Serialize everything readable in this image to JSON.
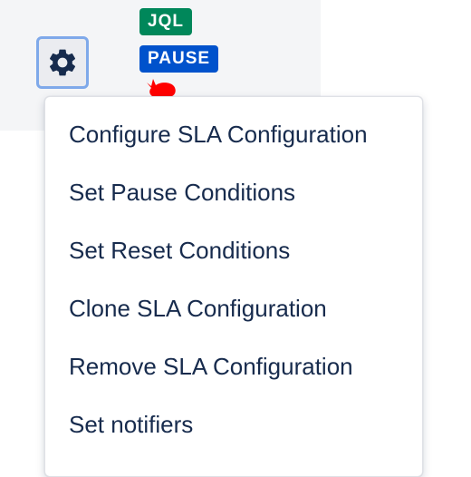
{
  "badges": {
    "jql": "JQL",
    "pause": "PAUSE"
  },
  "icons": {
    "settings": "gear-icon",
    "reset_indicator": "red-reset-icon"
  },
  "colors": {
    "jql_badge": "#00875a",
    "pause_badge": "#0052cc",
    "gear_focus_ring": "#7fa9ea",
    "menu_text": "#172b4d",
    "reset_indicator": "#ff0000"
  },
  "menu": {
    "items": [
      {
        "label": "Configure SLA Configuration"
      },
      {
        "label": "Set Pause Conditions"
      },
      {
        "label": "Set Reset Conditions"
      },
      {
        "label": "Clone SLA Configuration"
      },
      {
        "label": "Remove SLA Configuration"
      },
      {
        "label": "Set notifiers"
      }
    ]
  }
}
